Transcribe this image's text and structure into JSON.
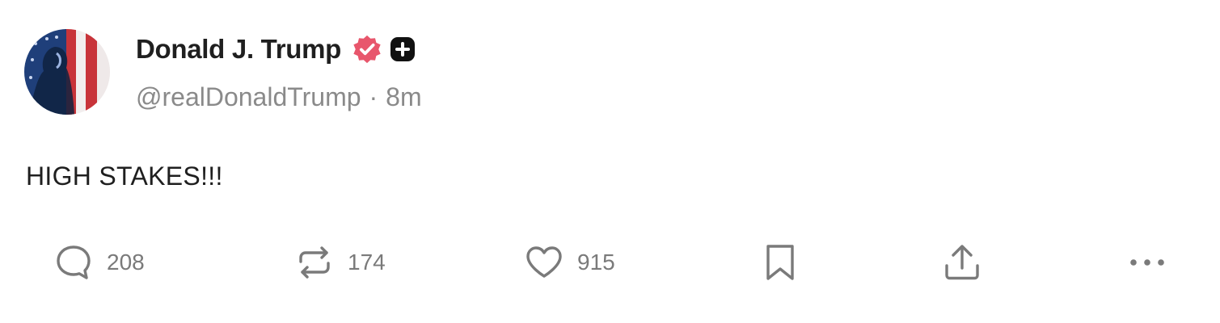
{
  "post": {
    "author": {
      "display_name": "Donald J. Trump",
      "handle": "@realDonaldTrump",
      "verified_icon": "verified-badge-icon",
      "extra_badge_icon": "plus-badge-icon"
    },
    "timestamp": "8m",
    "separator": "·",
    "text": "HIGH STAKES!!!"
  },
  "actions": {
    "reply": {
      "icon": "reply-icon",
      "count": "208"
    },
    "repost": {
      "icon": "repost-icon",
      "count": "174"
    },
    "like": {
      "icon": "heart-icon",
      "count": "915"
    },
    "bookmark": {
      "icon": "bookmark-icon"
    },
    "share": {
      "icon": "share-icon"
    },
    "more": {
      "icon": "more-icon"
    }
  },
  "colors": {
    "verified_badge": "#e8566c",
    "plus_badge": "#111111",
    "muted_text": "#8a8a8a",
    "primary_text": "#1f1f1f",
    "action_icon": "#7a7a7a"
  }
}
